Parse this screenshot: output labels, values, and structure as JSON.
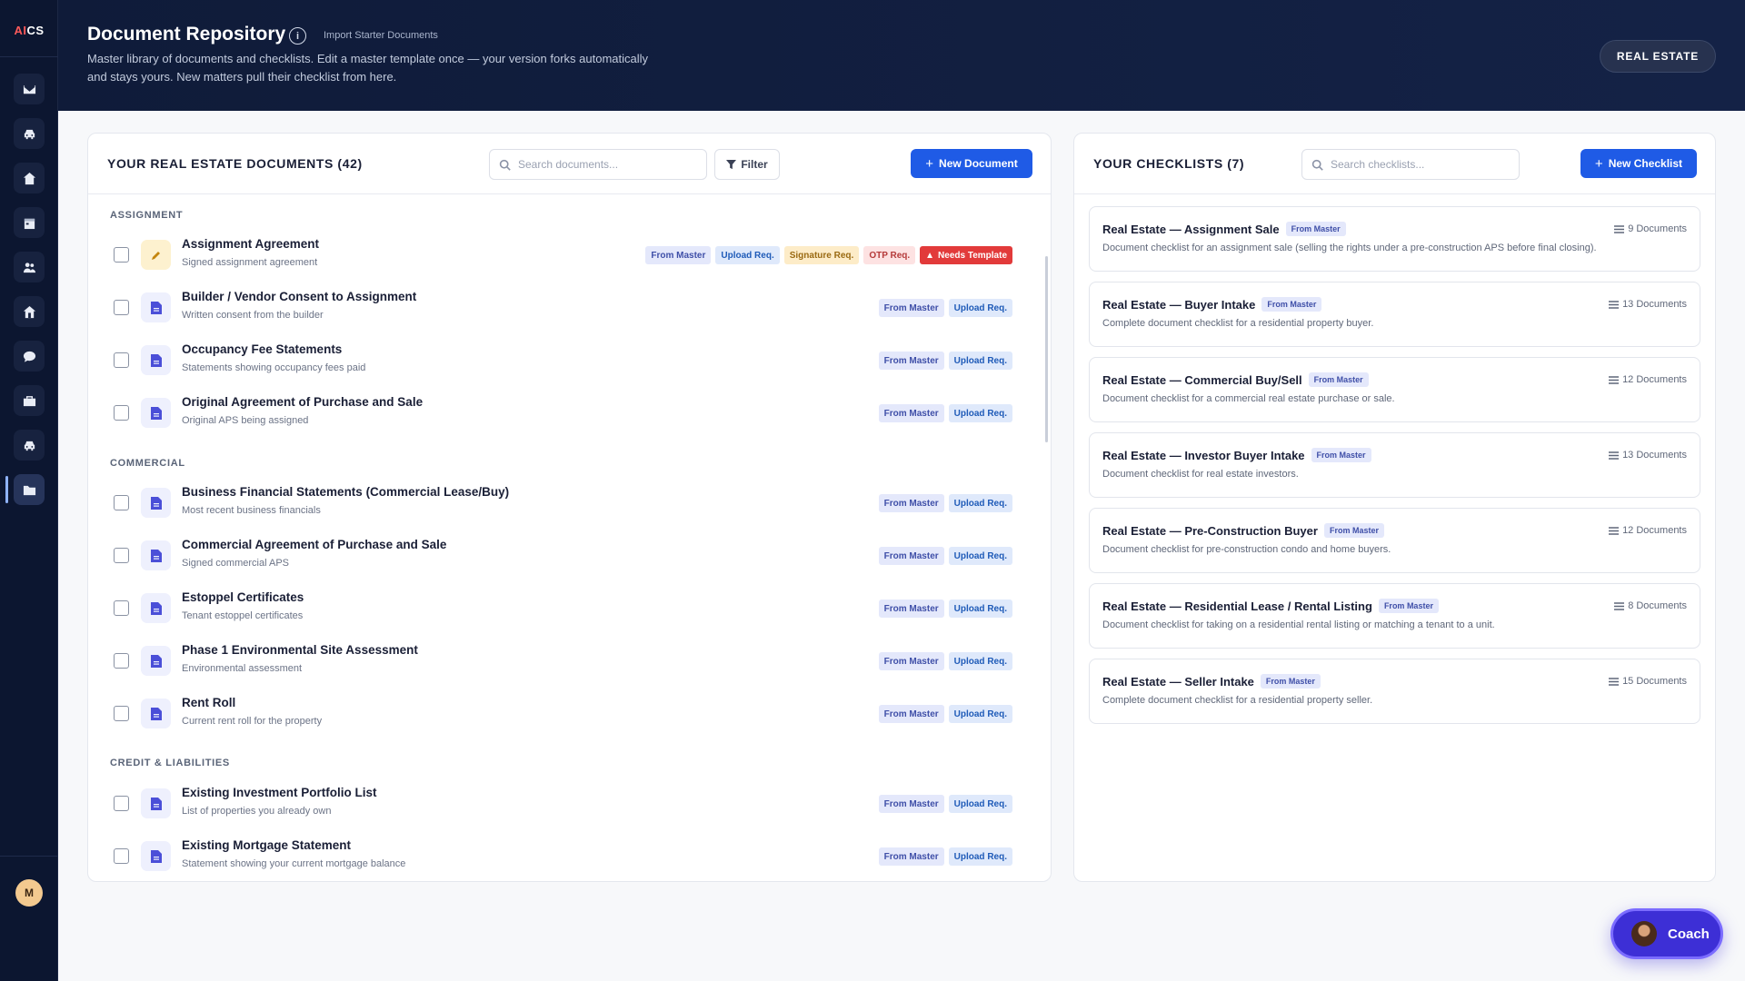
{
  "app": {
    "logo_ai": "AI",
    "logo_cs": "CS",
    "user_initial": "M"
  },
  "rail": {
    "items": [
      {
        "icon": "mail-icon"
      },
      {
        "icon": "car-icon"
      },
      {
        "icon": "home-icon"
      },
      {
        "icon": "calendar-icon"
      },
      {
        "icon": "users-icon"
      },
      {
        "icon": "home-icon-2"
      },
      {
        "icon": "chat-icon"
      },
      {
        "icon": "briefcase-icon"
      },
      {
        "icon": "car-icon-2"
      },
      {
        "icon": "folder-icon",
        "active": true
      }
    ]
  },
  "header": {
    "title": "Document Repository",
    "info_glyph": "i",
    "import_link": "Import Starter Documents",
    "subtitle": "Master library of documents and checklists. Edit a master template once — your version forks automatically and stays yours. New matters pull their checklist from here.",
    "practice_area": "REAL ESTATE"
  },
  "documents_panel": {
    "title": "YOUR REAL ESTATE DOCUMENTS (42)",
    "search_placeholder": "Search documents...",
    "filter_label": "Filter",
    "new_button": "New Document",
    "sections": [
      {
        "label": "ASSIGNMENT",
        "items": [
          {
            "name": "Assignment Agreement",
            "desc": "Signed assignment agreement",
            "icon": "edit-icon",
            "badges": [
              "From Master",
              "Upload Req.",
              "Signature Req.",
              "OTP Req.",
              "Needs Template"
            ]
          },
          {
            "name": "Builder / Vendor Consent to Assignment",
            "desc": "Written consent from the builder",
            "icon": "document-icon",
            "badges": [
              "From Master",
              "Upload Req."
            ]
          },
          {
            "name": "Occupancy Fee Statements",
            "desc": "Statements showing occupancy fees paid",
            "icon": "document-icon",
            "badges": [
              "From Master",
              "Upload Req."
            ]
          },
          {
            "name": "Original Agreement of Purchase and Sale",
            "desc": "Original APS being assigned",
            "icon": "document-icon",
            "badges": [
              "From Master",
              "Upload Req."
            ]
          }
        ]
      },
      {
        "label": "COMMERCIAL",
        "items": [
          {
            "name": "Business Financial Statements (Commercial Lease/Buy)",
            "desc": "Most recent business financials",
            "icon": "document-icon",
            "badges": [
              "From Master",
              "Upload Req."
            ]
          },
          {
            "name": "Commercial Agreement of Purchase and Sale",
            "desc": "Signed commercial APS",
            "icon": "document-icon",
            "badges": [
              "From Master",
              "Upload Req."
            ]
          },
          {
            "name": "Estoppel Certificates",
            "desc": "Tenant estoppel certificates",
            "icon": "document-icon",
            "badges": [
              "From Master",
              "Upload Req."
            ]
          },
          {
            "name": "Phase 1 Environmental Site Assessment",
            "desc": "Environmental assessment",
            "icon": "document-icon",
            "badges": [
              "From Master",
              "Upload Req."
            ]
          },
          {
            "name": "Rent Roll",
            "desc": "Current rent roll for the property",
            "icon": "document-icon",
            "badges": [
              "From Master",
              "Upload Req."
            ]
          }
        ]
      },
      {
        "label": "CREDIT & LIABILITIES",
        "items": [
          {
            "name": "Existing Investment Portfolio List",
            "desc": "List of properties you already own",
            "icon": "document-icon",
            "badges": [
              "From Master",
              "Upload Req."
            ]
          },
          {
            "name": "Existing Mortgage Statement",
            "desc": "Statement showing your current mortgage balance",
            "icon": "document-icon",
            "badges": [
              "From Master",
              "Upload Req."
            ]
          }
        ]
      }
    ]
  },
  "checklists_panel": {
    "title": "YOUR CHECKLISTS (7)",
    "search_placeholder": "Search checklists...",
    "new_button": "New Checklist",
    "items": [
      {
        "title": "Real Estate — Assignment Sale",
        "badge": "From Master",
        "count": "9 Documents",
        "desc": "Document checklist for an assignment sale (selling the rights under a pre-construction APS before final closing)."
      },
      {
        "title": "Real Estate — Buyer Intake",
        "badge": "From Master",
        "count": "13 Documents",
        "desc": "Complete document checklist for a residential property buyer."
      },
      {
        "title": "Real Estate — Commercial Buy/Sell",
        "badge": "From Master",
        "count": "12 Documents",
        "desc": "Document checklist for a commercial real estate purchase or sale."
      },
      {
        "title": "Real Estate — Investor Buyer Intake",
        "badge": "From Master",
        "count": "13 Documents",
        "desc": "Document checklist for real estate investors."
      },
      {
        "title": "Real Estate — Pre-Construction Buyer",
        "badge": "From Master",
        "count": "12 Documents",
        "desc": "Document checklist for pre-construction condo and home buyers."
      },
      {
        "title": "Real Estate — Residential Lease / Rental Listing",
        "badge": "From Master",
        "count": "8 Documents",
        "desc": "Document checklist for taking on a residential rental listing or matching a tenant to a unit."
      },
      {
        "title": "Real Estate — Seller Intake",
        "badge": "From Master",
        "count": "15 Documents",
        "desc": "Complete document checklist for a residential property seller."
      }
    ]
  },
  "coach": {
    "label": "Coach"
  },
  "colors": {
    "accent": "#1f5be6",
    "header_bg": "#0f1b39",
    "rail_bg": "#0c1630",
    "danger": "#e23a3a"
  }
}
